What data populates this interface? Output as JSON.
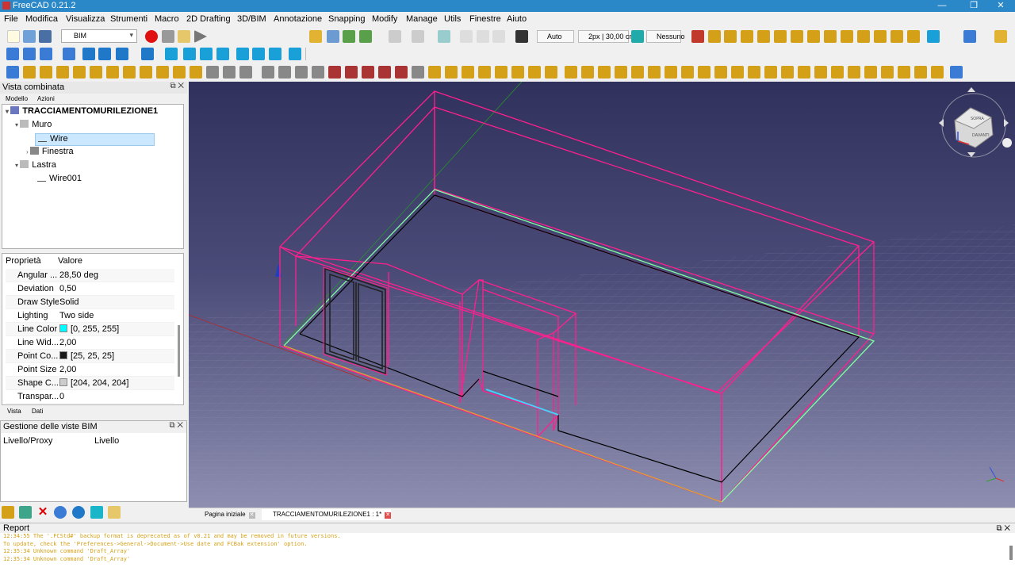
{
  "window": {
    "title": "FreeCAD 0.21.2"
  },
  "menu": [
    "File",
    "Modifica",
    "Visualizza",
    "Strumenti",
    "Macro",
    "2D Drafting",
    "3D/BIM",
    "Annotazione",
    "Snapping",
    "Modify",
    "Manage",
    "Utils",
    "Finestre",
    "Aiuto"
  ],
  "toolbar": {
    "workbench": "BIM",
    "snap_mode": "Auto",
    "line_style": "2px | 30,00 cm",
    "layer": "Nessuno"
  },
  "combo_view": {
    "title": "Vista combinata",
    "tabs": [
      "Modello",
      "Azioni"
    ],
    "tree": [
      {
        "label": "TRACCIAMENTOMURILEZIONE1",
        "icon": "document-icon"
      },
      {
        "label": "Muro",
        "icon": "wall-icon"
      },
      {
        "label": "Wire",
        "icon": "wire-icon",
        "selected": true
      },
      {
        "label": "Finestra",
        "icon": "window-icon"
      },
      {
        "label": "Lastra",
        "icon": "slab-icon"
      },
      {
        "label": "Wire001",
        "icon": "wire-icon"
      }
    ],
    "property_headers": [
      "Proprietà",
      "Valore"
    ],
    "properties": [
      {
        "key": "Angular ...",
        "value": "28,50 deg"
      },
      {
        "key": "Deviation",
        "value": "0,50"
      },
      {
        "key": "Draw Style",
        "value": "Solid"
      },
      {
        "key": "Lighting",
        "value": "Two side"
      },
      {
        "key": "Line Color",
        "value": "[0, 255, 255]",
        "color": "#00ffff"
      },
      {
        "key": "Line Wid...",
        "value": "2,00"
      },
      {
        "key": "Point Co...",
        "value": "[25, 25, 25]",
        "color": "#191919"
      },
      {
        "key": "Point Size",
        "value": "2,00"
      },
      {
        "key": "Shape C...",
        "value": "[204, 204, 204]",
        "color": "#cccccc"
      },
      {
        "key": "Transpar...",
        "value": "0"
      }
    ],
    "prop_tabs": [
      "Vista",
      "Dati"
    ]
  },
  "bim_views": {
    "title": "Gestione delle viste BIM",
    "columns": [
      "Livello/Proxy",
      "Livello"
    ]
  },
  "navcube": {
    "top": "SOPRA",
    "front": "DAVANTI"
  },
  "doc_tabs": [
    "Pagina iniziale",
    "TRACCIAMENTOMURILEZIONE1 : 1*"
  ],
  "report": {
    "title": "Report",
    "lines": [
      "12:34:55  The '.FCStd#' backup format is deprecated as of v0.21 and may be removed in future versions.",
      "To update, check the 'Preferences->General->Document->Use date and FCBak extension' option.",
      "12:35:34  Unknown command 'Draft_Array'",
      "12:35:34  Unknown command 'Draft_Array'"
    ]
  },
  "colors": {
    "wall_lines": "#ff1f8e",
    "wire_line": "#000000",
    "slab_edge": "#7fffa0",
    "selected_edge": "#3fd7ff",
    "titlebar": "#2b88c8"
  }
}
